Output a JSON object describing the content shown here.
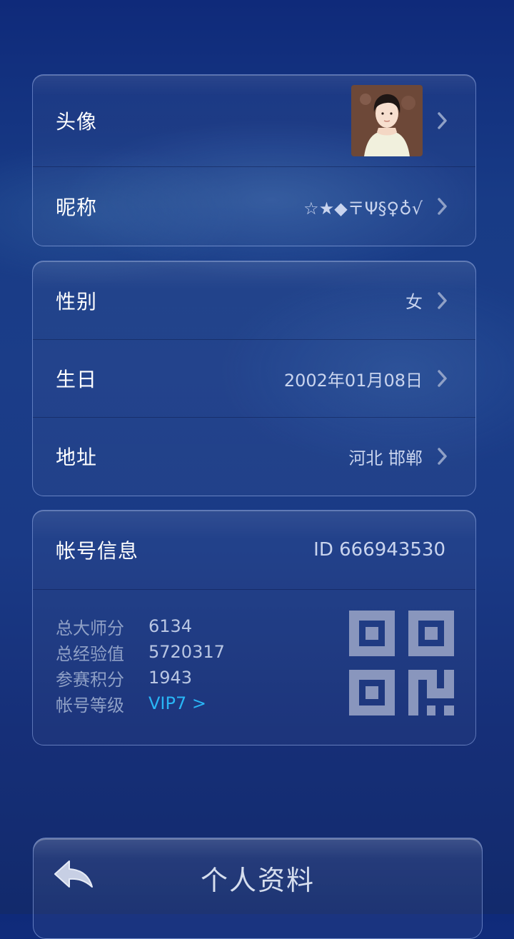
{
  "profile": {
    "avatar": {
      "label": "头像"
    },
    "nickname": {
      "label": "昵称",
      "value": "☆★◆〒Ψ§♀♁√"
    }
  },
  "details": {
    "gender": {
      "label": "性别",
      "value": "女"
    },
    "birthday": {
      "label": "生日",
      "value": "2002年01月08日"
    },
    "address": {
      "label": "地址",
      "value": "河北 邯郸"
    }
  },
  "account": {
    "title": "帐号信息",
    "id_text": "ID  666943530",
    "stats": [
      {
        "label": "总大师分",
        "value": "6134"
      },
      {
        "label": "总经验值",
        "value": "5720317"
      },
      {
        "label": "参赛积分",
        "value": "1943"
      }
    ],
    "level": {
      "label": "帐号等级",
      "value": "VIP7 >"
    }
  },
  "bottom_bar": {
    "title": "个人资料"
  },
  "icons": {
    "chevron": "chevron-right-icon",
    "back": "back-arrow-icon",
    "qr": "qr-code-icon"
  },
  "colors": {
    "link": "#29b6f6",
    "label_dim": "#8fa0c6",
    "value": "#c9d4ee"
  }
}
